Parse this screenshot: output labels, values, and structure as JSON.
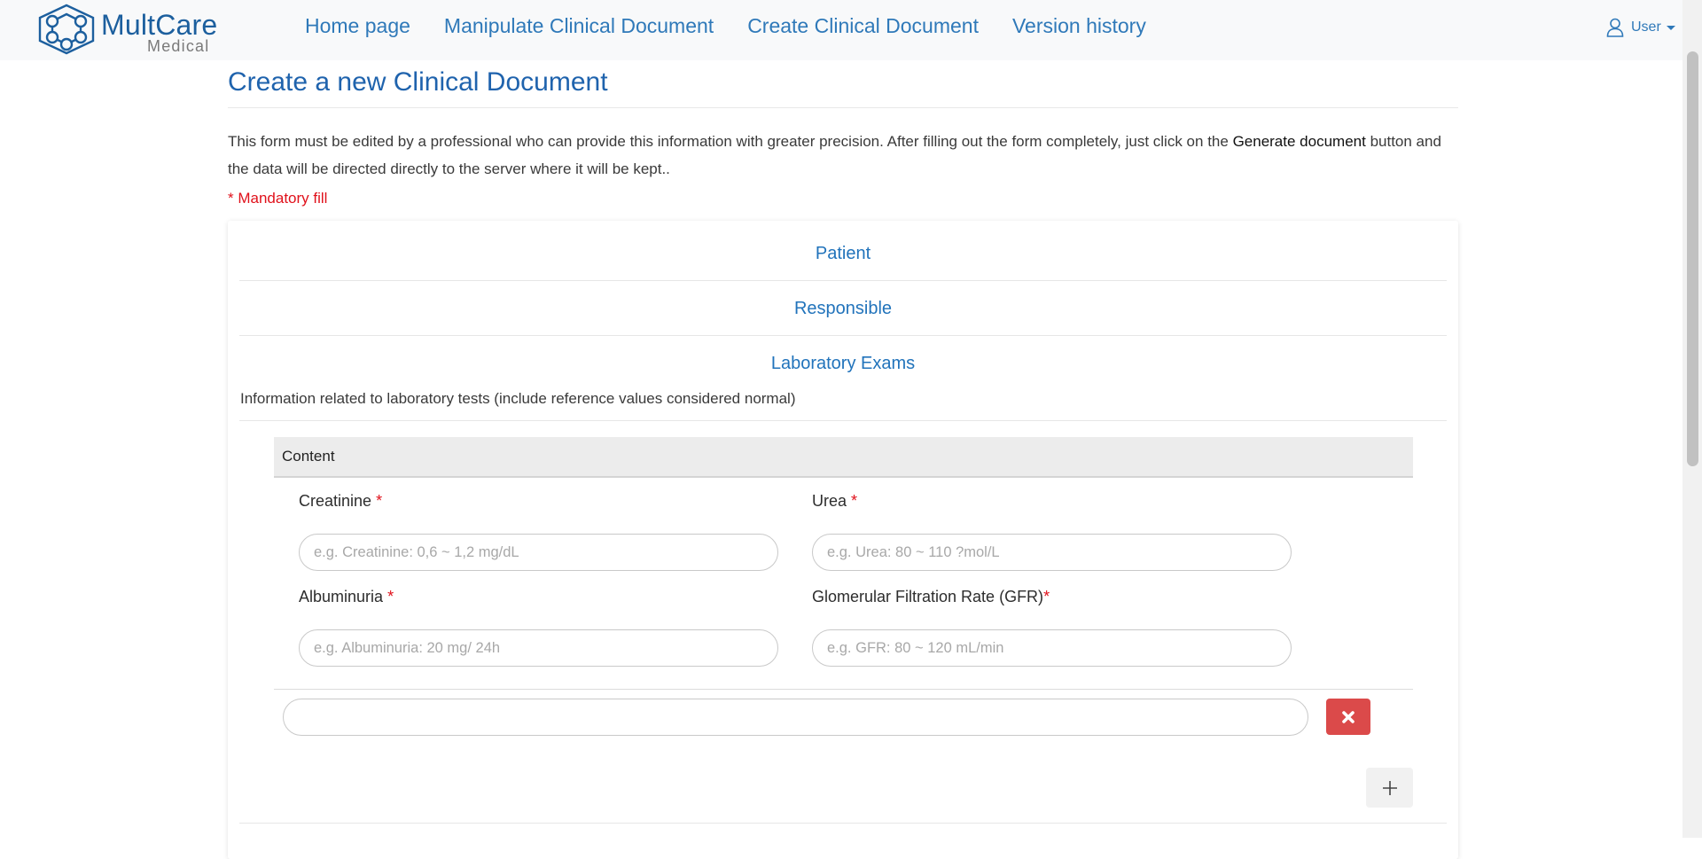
{
  "brand": {
    "name": "MultCare",
    "subtitle": "Medical"
  },
  "nav": {
    "links": [
      {
        "label": "Home page"
      },
      {
        "label": "Manipulate Clinical Document"
      },
      {
        "label": "Create Clinical Document"
      },
      {
        "label": "Version history"
      }
    ],
    "user_label": "User",
    "user_icon": "user-icon"
  },
  "page": {
    "title": "Create a new Clinical Document",
    "intro_text": "This form must be edited by a professional who can provide this information with greater precision. After filling out the form completely, just click on the",
    "intro_bold": "Generate document",
    "intro_tail": "button and the data will be directed directly to the server where it will be kept..",
    "mandatory_note": "* Mandatory fill"
  },
  "sections": [
    {
      "label": "Patient"
    },
    {
      "label": "Responsible"
    },
    {
      "label": "Laboratory Exams"
    }
  ],
  "lab_exams": {
    "description": "Information related to laboratory tests (include reference values considered normal)",
    "content_heading": "Content",
    "required_marker": "*",
    "fields": {
      "creatinine": {
        "label": "Creatinine",
        "placeholder": "e.g. Creatinine: 0,6 ~ 1,2 mg/dL",
        "value": ""
      },
      "urea": {
        "label": "Urea",
        "placeholder": "e.g. Urea: 80 ~ 110 ?mol/L",
        "value": ""
      },
      "albuminuria": {
        "label": "Albuminuria",
        "placeholder": "e.g. Albuminuria: 20 mg/ 24h",
        "value": ""
      },
      "gfr": {
        "label": "Glomerular Filtration Rate (GFR)",
        "placeholder": "e.g. GFR: 80 ~ 120 mL/min",
        "value": ""
      }
    },
    "extra_field": {
      "value": "",
      "placeholder": ""
    },
    "remove_icon": "close-icon",
    "add_icon": "plus-icon"
  },
  "colors": {
    "brand": "#1c5f9e",
    "link": "#2f79b9",
    "title": "#1f63ad",
    "required": "#e0111b",
    "danger": "#db4a4a"
  }
}
